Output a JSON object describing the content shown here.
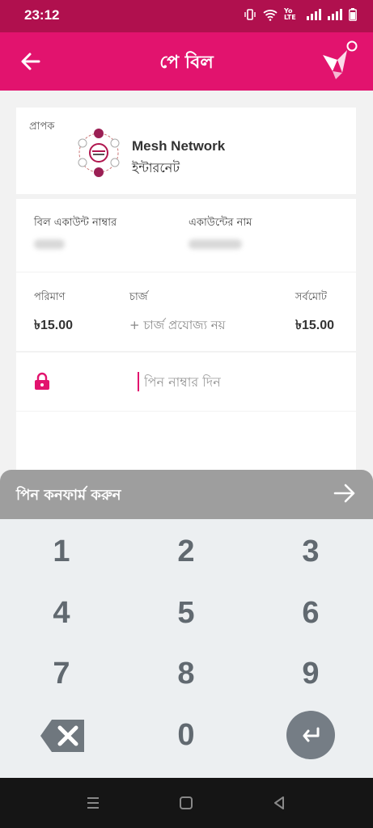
{
  "status_bar": {
    "time": "23:12",
    "network_label": "Yo LTE"
  },
  "app_bar": {
    "title": "পে বিল"
  },
  "recipient": {
    "label": "প্রাপক",
    "merchant_name": "Mesh Network",
    "category": "ইন্টারনেট"
  },
  "account": {
    "number_label": "বিল একাউন্ট নাম্বার",
    "name_label": "একাউন্টের নাম"
  },
  "payment": {
    "amount_label": "পরিমাণ",
    "amount": "৳15.00",
    "charge_label": "চার্জ",
    "charge_value": "+ চার্জ প্রযোজ্য নয়",
    "total_label": "সর্বমোট",
    "total": "৳15.00"
  },
  "pin": {
    "placeholder": "পিন নাম্বার দিন"
  },
  "confirm": {
    "label": "পিন কনফার্ম করুন"
  },
  "keypad": {
    "keys": [
      "1",
      "2",
      "3",
      "4",
      "5",
      "6",
      "7",
      "8",
      "9",
      "0"
    ]
  },
  "colors": {
    "brand": "#e2136e",
    "status_bar": "#b0104e",
    "confirm_bar": "#9e9e9e",
    "keypad_bg": "#eceff1"
  }
}
